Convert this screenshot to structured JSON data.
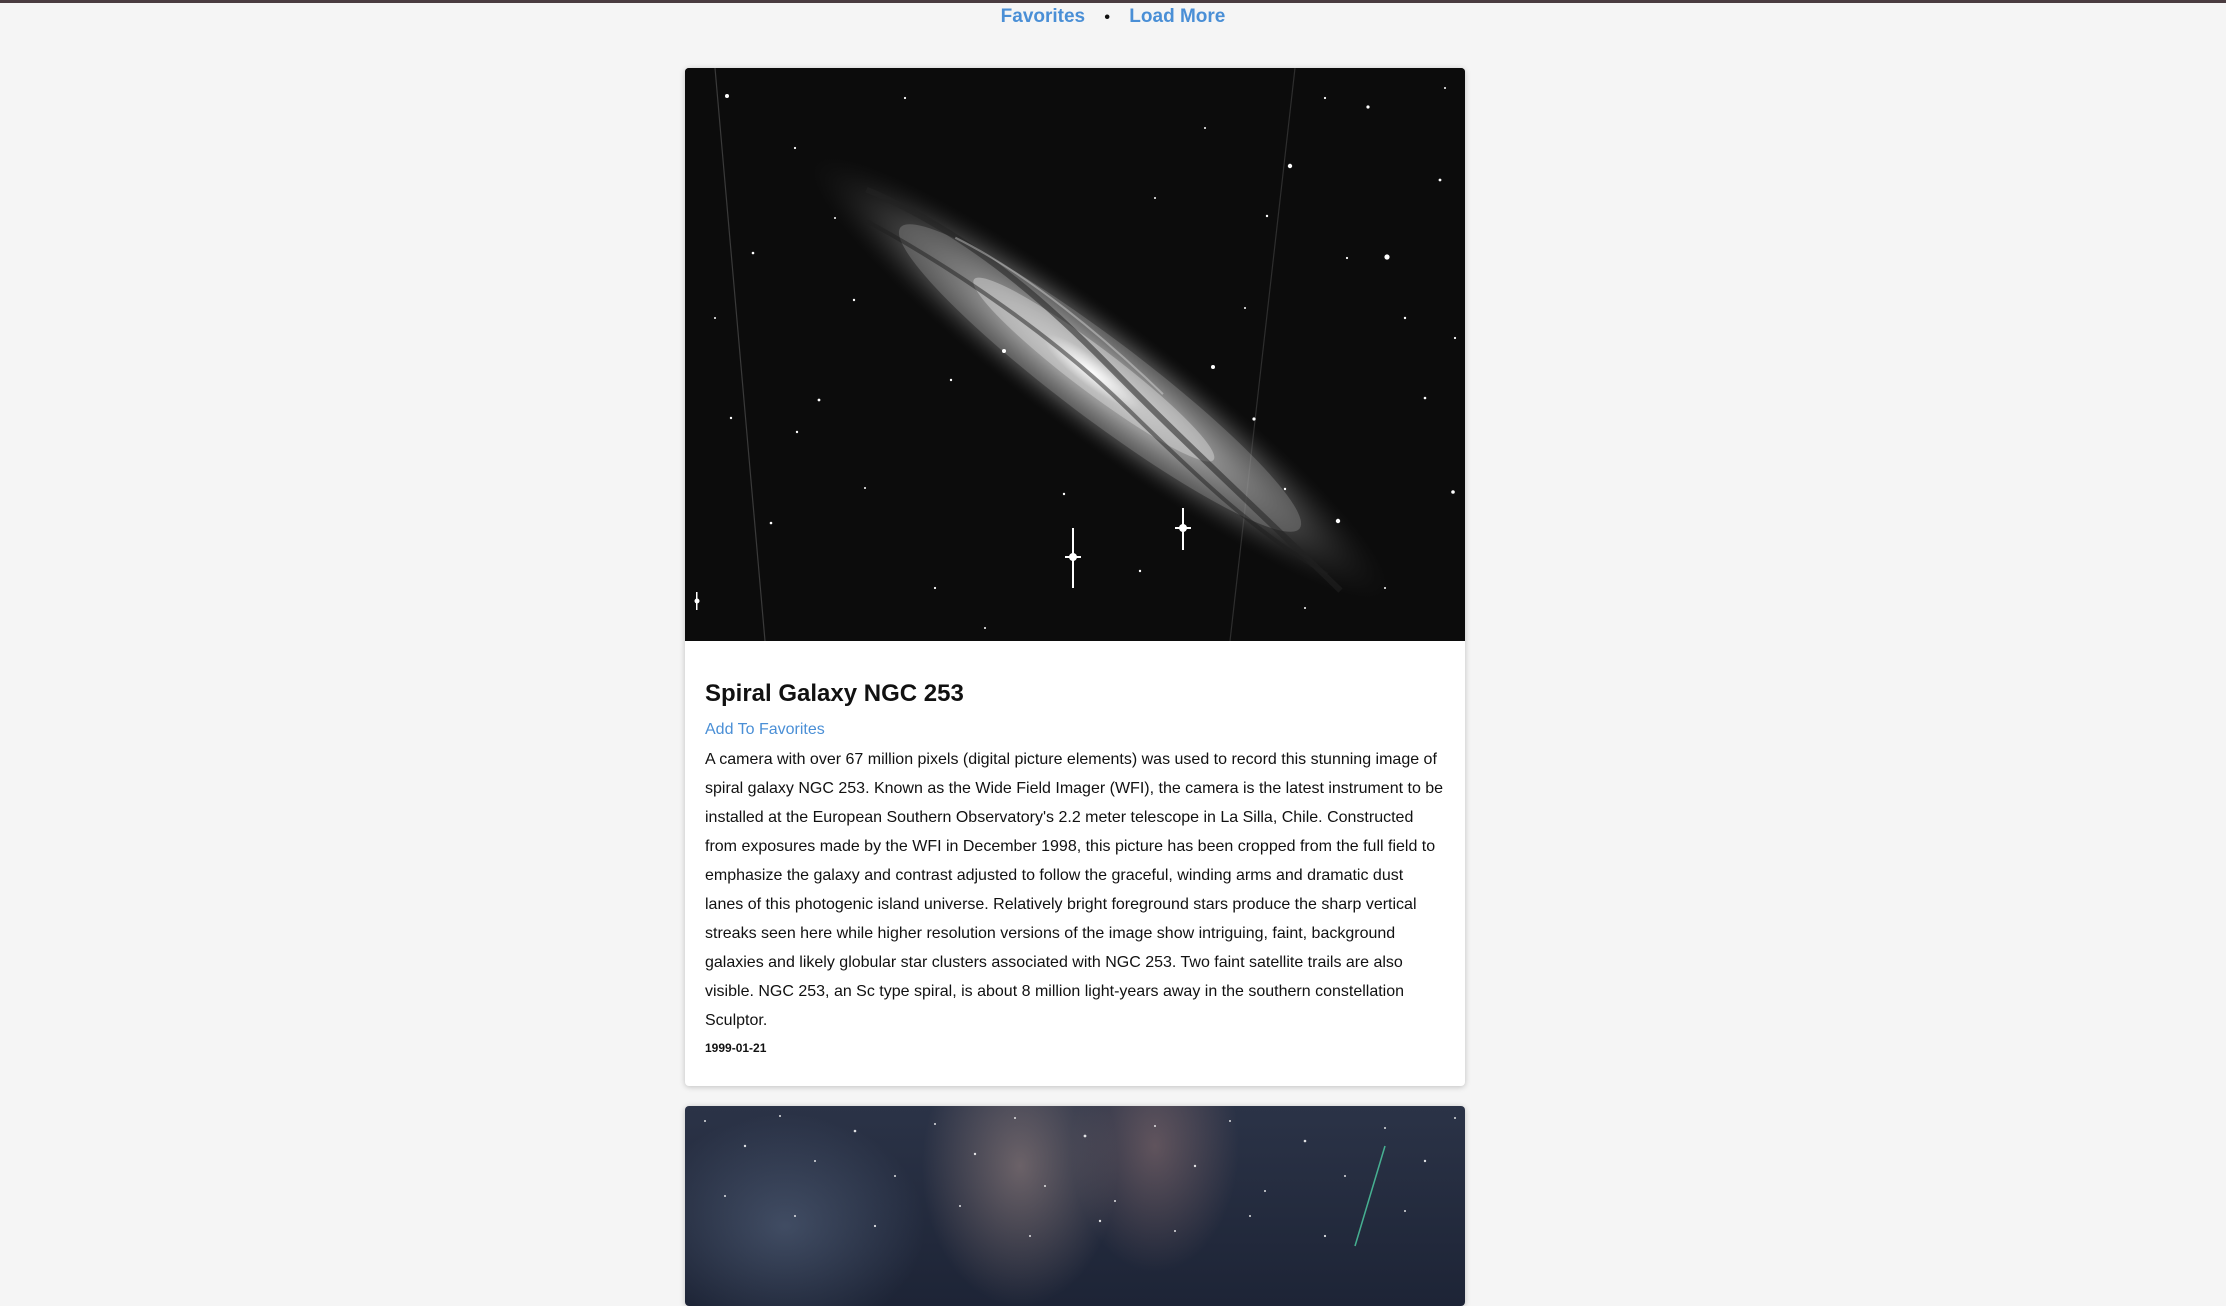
{
  "nav": {
    "favorites_label": "Favorites",
    "separator": "•",
    "load_more_label": "Load More"
  },
  "posts": [
    {
      "title": "Spiral Galaxy NGC 253",
      "add_favorite_label": "Add To Favorites",
      "description": "A camera with over 67 million pixels (digital picture elements) was used to record this stunning image of spiral galaxy NGC 253. Known as the Wide Field Imager (WFI), the camera is the latest instrument to be installed at the European Southern Observatory's 2.2 meter telescope in La Silla, Chile. Constructed from exposures made by the WFI in December 1998, this picture has been cropped from the full field to emphasize the galaxy and contrast adjusted to follow the graceful, winding arms and dramatic dust lanes of this photogenic island universe. Relatively bright foreground stars produce the sharp vertical streaks seen here while higher resolution versions of the image show intriguing, faint, background galaxies and likely globular star clusters associated with NGC 253. Two faint satellite trails are also visible. NGC 253, an Sc type spiral, is about 8 million light-years away in the southern constellation Sculptor.",
      "date": "1999-01-21"
    }
  ],
  "colors": {
    "link": "#4a8fd6",
    "page_background": "#f5f5f5",
    "card_background": "#ffffff",
    "top_border": "#4a3c40"
  }
}
